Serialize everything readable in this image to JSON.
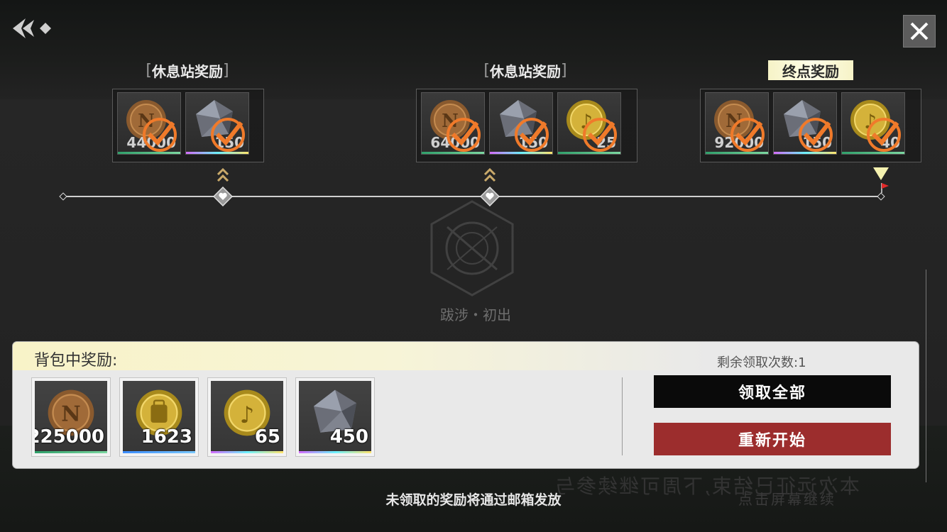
{
  "colors": {
    "check": "#f07a2a",
    "panel_bg": "#e9e9e9",
    "claim_button": "#0a0a0a",
    "restart_button": "#9c2d2d",
    "final_title_bg": "#f8f4c9"
  },
  "stages": [
    {
      "title": "休息站奖励",
      "rewards": [
        {
          "icon": "bronze-coin-icon",
          "qty": "44000",
          "claimed": true
        },
        {
          "icon": "crystal-icon",
          "qty": "150",
          "claimed": true
        }
      ]
    },
    {
      "title": "休息站奖励",
      "rewards": [
        {
          "icon": "bronze-coin-icon",
          "qty": "64000",
          "claimed": true
        },
        {
          "icon": "crystal-icon",
          "qty": "150",
          "claimed": true
        },
        {
          "icon": "gold-note-coin-icon",
          "qty": "25",
          "claimed": true
        }
      ]
    },
    {
      "title": "终点奖励",
      "rewards": [
        {
          "icon": "bronze-coin-icon",
          "qty": "92000",
          "claimed": true
        },
        {
          "icon": "crystal-icon",
          "qty": "150",
          "claimed": true
        },
        {
          "icon": "gold-note-coin-icon",
          "qty": "40",
          "claimed": true
        }
      ]
    }
  ],
  "stage_name": "跋涉・初出",
  "panel": {
    "title": "背包中奖励:",
    "remaining_label": "剩余领取次数:1",
    "items": [
      {
        "icon": "bronze-coin-icon",
        "qty": "225000"
      },
      {
        "icon": "gold-bag-coin-icon",
        "qty": "1623"
      },
      {
        "icon": "gold-note-coin-icon",
        "qty": "65"
      },
      {
        "icon": "crystal-icon",
        "qty": "450"
      }
    ],
    "claim_all": "领取全部",
    "restart": "重新开始"
  },
  "footer_note": "未领取的奖励将通过邮箱发放",
  "background_text": {
    "line1": "本次远征已结束,下周可继续参与",
    "line2": "点击屏幕继续"
  }
}
